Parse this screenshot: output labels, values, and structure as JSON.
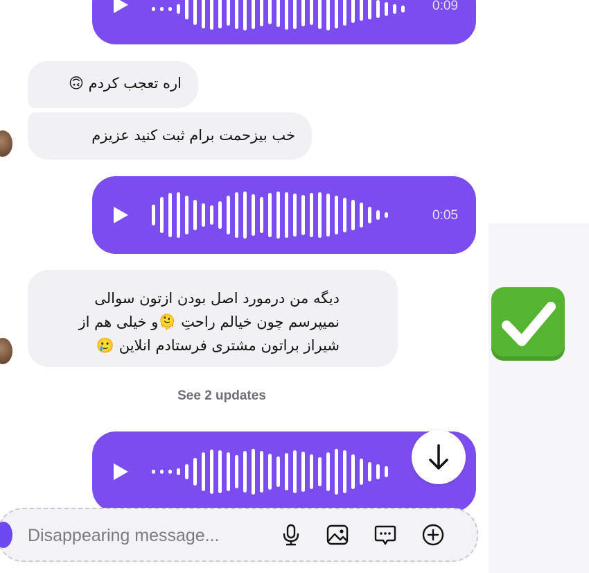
{
  "messages": {
    "voice_1": {
      "duration": "0:09"
    },
    "text_1": "اره تعجب کردم 🙃",
    "text_2": "خب بیزحمت برام ثبت کنید عزیزم",
    "voice_2": {
      "duration": "0:05"
    },
    "text_3": {
      "line_1": "دیگه من درمورد اصل بودن ازتون سوالی",
      "line_2": "نمیپرسم چون خیالم راحتِ 🫠و خیلی هم از",
      "line_3": "شیراز براتون مشتری فرستادم انلاین 🥲"
    },
    "reaction_emoji": "✅",
    "voice_3": {
      "duration": ""
    }
  },
  "see_updates": "See 2 updates",
  "composer": {
    "placeholder": "Disappearing message...",
    "icons": [
      "microphone-icon",
      "image-icon",
      "chat-bubble-icon",
      "plus-circle-icon"
    ]
  },
  "colors": {
    "voice_bubble": "#7c4dee",
    "text_bubble": "#f1f1f4",
    "check_green": "#55b531"
  }
}
